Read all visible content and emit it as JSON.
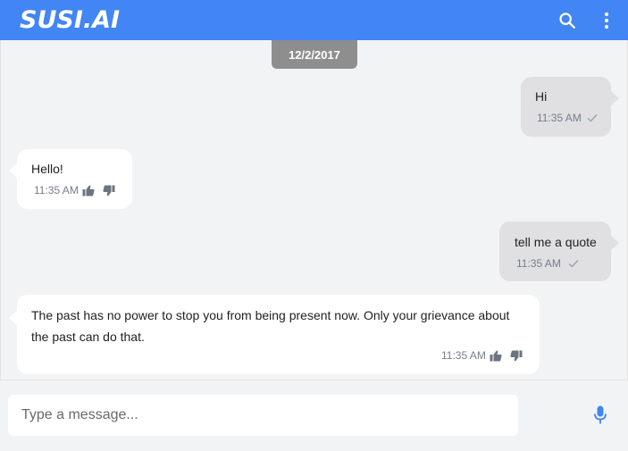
{
  "app": {
    "logo_text": "SUSI.AI",
    "brand_color": "#4285f4"
  },
  "header": {
    "search_icon": "search-icon",
    "more_icon": "more-vert-icon"
  },
  "chat": {
    "date_label": "12/2/2017",
    "messages": [
      {
        "direction": "out",
        "text": "Hi",
        "time": "11:35 AM",
        "status_icon": "check-icon"
      },
      {
        "direction": "in",
        "text": "Hello!",
        "time": "11:35 AM",
        "icons": [
          "thumbs-up-icon",
          "thumbs-down-icon"
        ]
      },
      {
        "direction": "out",
        "text": "tell me a quote",
        "time": "11:35 AM",
        "status_icon": "check-icon"
      },
      {
        "direction": "in",
        "text": "The past has no power to stop you from being present now. Only your grievance about the past can do that.",
        "time": "11:35 AM",
        "icons": [
          "thumbs-up-icon",
          "thumbs-down-icon"
        ]
      }
    ]
  },
  "composer": {
    "placeholder": "Type a message...",
    "value": "",
    "mic_icon": "mic-icon",
    "mic_color": "#4285f4"
  }
}
